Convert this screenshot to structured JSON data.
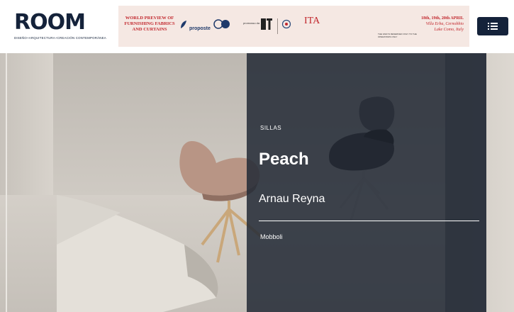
{
  "header": {
    "logo_text": "ROOM",
    "logo_tagline": "DISEÑO+ARQUITECTURA+CREACIÓN CONTEMPORÁNEA",
    "menu_icon": "list-icon"
  },
  "banner": {
    "headline": "WORLD PREVIEW OF FURNISHING FABRICS AND CURTAINS",
    "date": "18th, 19th, 20th APRIL",
    "place_line1": "Villa Erba, Cernobbio",
    "place_line2": "Lake Como, Italy",
    "small_text": "THE FAIR IS RESERVED ONLY TO THE OPERATORS ONLY",
    "partner": "proposte",
    "ita": "ITA"
  },
  "hero": {
    "category": "SILLAS",
    "title": "Peach",
    "designer": "Arnau Reyna",
    "brand": "Mobboli"
  },
  "colors": {
    "navy": "#14223a",
    "banner_bg": "#f5e8e3",
    "banner_red": "#c2272d",
    "overlay": "#232a36"
  }
}
